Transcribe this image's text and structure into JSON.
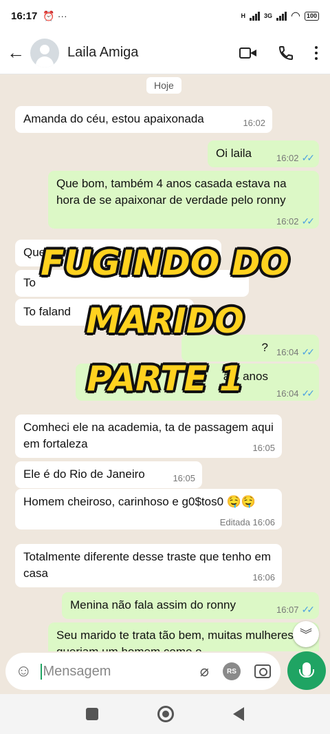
{
  "status": {
    "time": "16:17",
    "extra_icons": "⏰ ···",
    "net1": "H",
    "net2": "3G",
    "battery": "100"
  },
  "header": {
    "contact_name": "Laila Amiga"
  },
  "chat": {
    "day_label": "Hoje",
    "messages": [
      {
        "dir": "in",
        "text": "Amanda do céu, estou apaixonada",
        "time": "16:02"
      },
      {
        "dir": "out",
        "text": "Oi laila",
        "time": "16:02"
      },
      {
        "dir": "out",
        "text": "Que bom, também 4 anos casada estava na hora de se apaixonar de verdade pelo ronny",
        "time": "16:02"
      },
      {
        "dir": "in",
        "text": "Que",
        "time": ""
      },
      {
        "dir": "in",
        "text": "To",
        "time": ""
      },
      {
        "dir": "in",
        "text": "To faland",
        "time": ""
      },
      {
        "dir": "out",
        "text": "?",
        "time": "16:04"
      },
      {
        "dir": "out",
        "text": "a 4 anos",
        "time": "16:04"
      },
      {
        "dir": "in",
        "text": "Comheci ele na academia, ta de passagem aqui em fortaleza",
        "time": "16:05"
      },
      {
        "dir": "in",
        "text": "Ele é do Rio de Janeiro",
        "time": "16:05"
      },
      {
        "dir": "in",
        "text": "Homem cheiroso, carinhoso e g0$tos0 🤤🤤",
        "time": "Editada 16:06"
      },
      {
        "dir": "in",
        "text": "Totalmente diferente desse traste que tenho em casa",
        "time": "16:06"
      },
      {
        "dir": "out",
        "text": "Menina não fala assim do ronny",
        "time": "16:07"
      },
      {
        "dir": "out",
        "text": "Seu marido te trata tão bem, muitas mulheres queriam um homem como o",
        "time": ""
      }
    ]
  },
  "overlay": {
    "line1": "FUGINDO DO",
    "line2": "MARIDO",
    "line3": "PARTE 1"
  },
  "composer": {
    "placeholder": "Mensagem",
    "rs_label": "RS"
  },
  "colors": {
    "outgoing": "#dcf8c6",
    "accent": "#1fa463",
    "overlay_text": "#ffd21f"
  },
  "icons": [
    "back-arrow-icon",
    "avatar-icon",
    "video-call-icon",
    "phone-icon",
    "menu-icon",
    "double-check-icon",
    "scroll-down-icon",
    "emoji-icon",
    "attach-icon",
    "camera-icon",
    "mic-icon"
  ]
}
